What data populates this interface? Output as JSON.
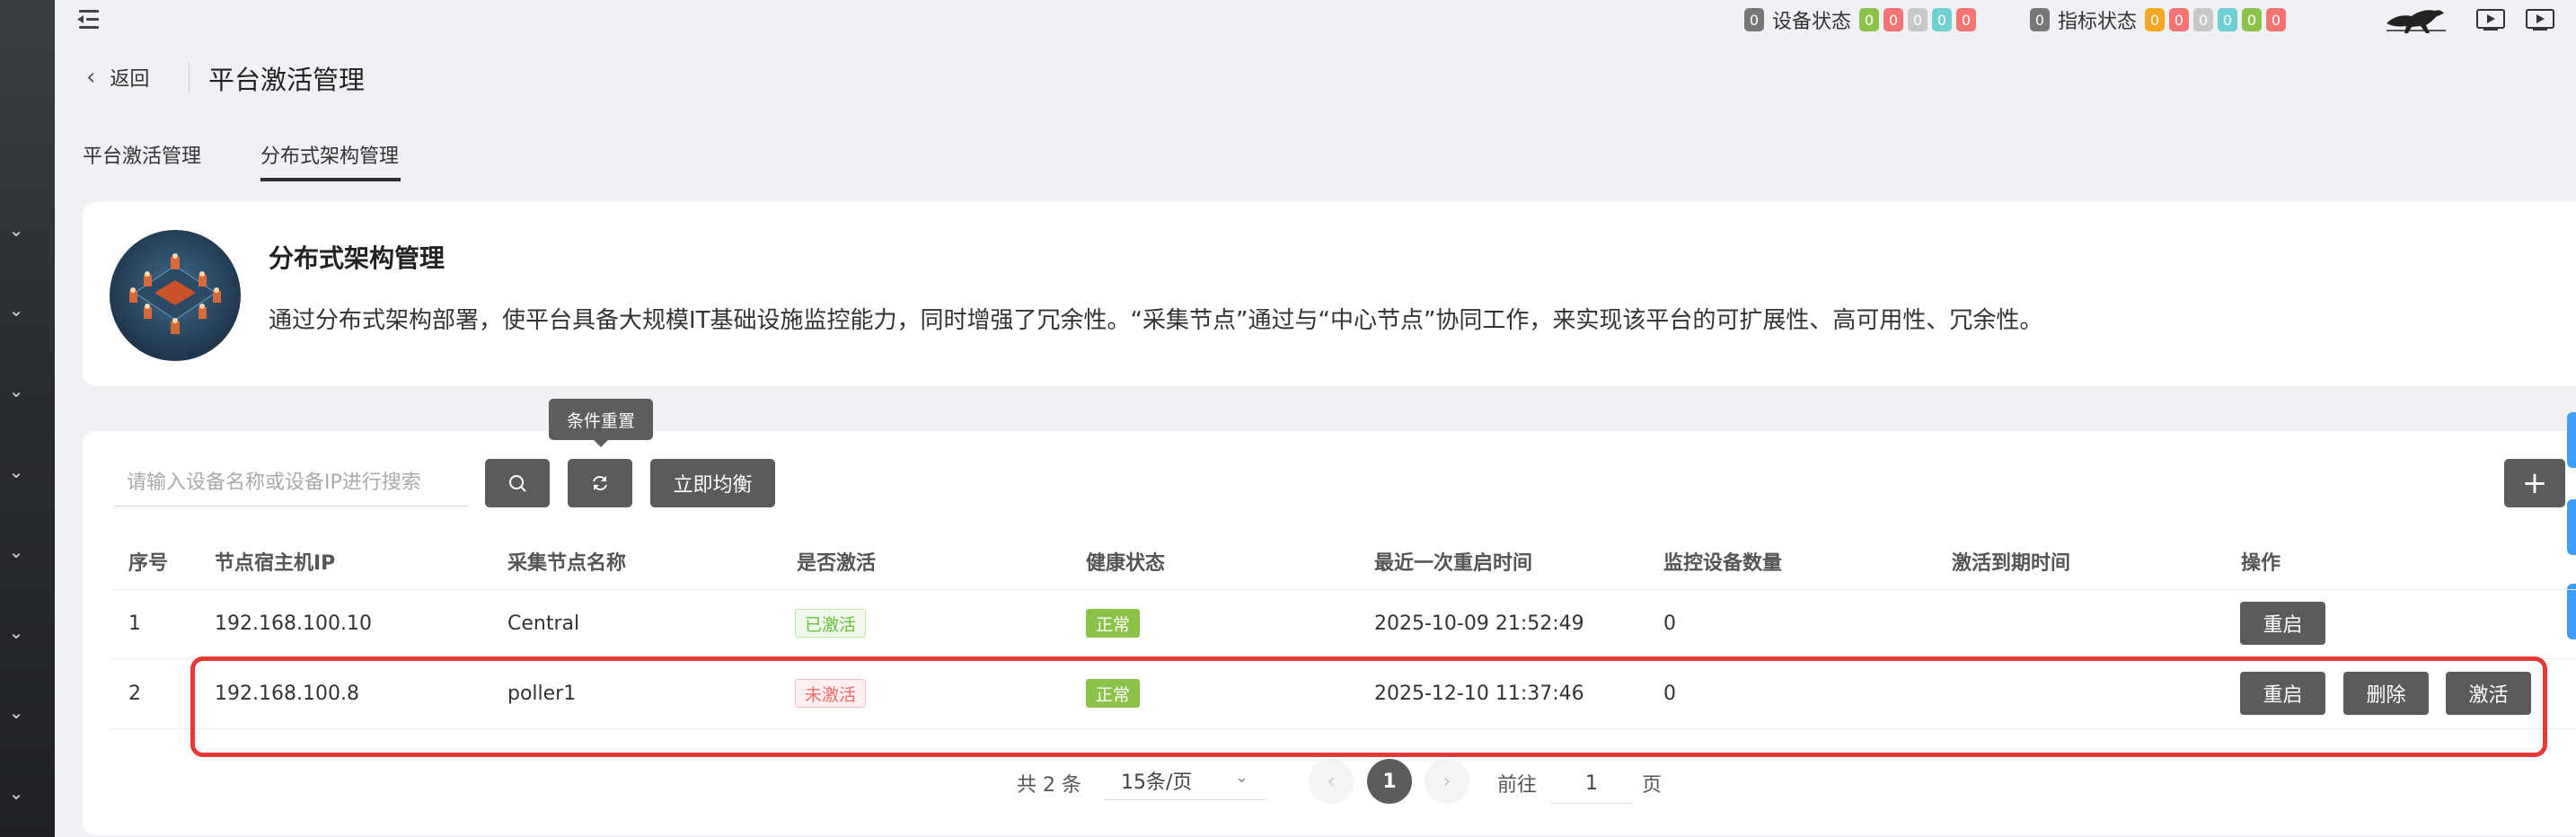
{
  "topbar": {
    "device_status_count": "0",
    "device_status_label": "设备状态",
    "device_badges": [
      {
        "value": "0",
        "color": "#8bc34a"
      },
      {
        "value": "0",
        "color": "#f57373"
      },
      {
        "value": "0",
        "color": "#c8c8c8"
      },
      {
        "value": "0",
        "color": "#6fcfd1"
      },
      {
        "value": "0",
        "color": "#f57373"
      }
    ],
    "metric_status_count": "0",
    "metric_status_label": "指标状态",
    "metric_badges": [
      {
        "value": "0",
        "color": "#f5a623"
      },
      {
        "value": "0",
        "color": "#f57373"
      },
      {
        "value": "0",
        "color": "#c8c8c8"
      },
      {
        "value": "0",
        "color": "#6fcfd1"
      },
      {
        "value": "0",
        "color": "#8bc34a"
      },
      {
        "value": "0",
        "color": "#f57373"
      }
    ],
    "neutral_color": "#777777"
  },
  "header": {
    "back_label": "返回",
    "title": "平台激活管理"
  },
  "tabs": [
    {
      "label": "平台激活管理",
      "active": false
    },
    {
      "label": "分布式架构管理",
      "active": true
    }
  ],
  "info_card": {
    "title": "分布式架构管理",
    "description": "通过分布式架构部署，使平台具备大规模IT基础设施监控能力，同时增强了冗余性。“采集节点”通过与“中心节点”协同工作，来实现该平台的可扩展性、高可用性、冗余性。"
  },
  "toolbar": {
    "search_placeholder": "请输入设备名称或设备IP进行搜索",
    "tooltip": "条件重置",
    "balance_label": "立即均衡",
    "add_icon": "+"
  },
  "table": {
    "headers": [
      "序号",
      "节点宿主机IP",
      "采集节点名称",
      "是否激活",
      "健康状态",
      "最近一次重启时间",
      "监控设备数量",
      "激活到期时间",
      "操作"
    ],
    "rows": [
      {
        "index": "1",
        "ip": "192.168.100.10",
        "name": "Central",
        "activated": "已激活",
        "health": "正常",
        "last_restart": "2025-10-09 21:52:49",
        "device_count": "0",
        "expire": "",
        "actions": [
          "重启"
        ]
      },
      {
        "index": "2",
        "ip": "192.168.100.8",
        "name": "poller1",
        "activated": "未激活",
        "health": "正常",
        "last_restart": "2025-12-10 11:37:46",
        "device_count": "0",
        "expire": "",
        "actions": [
          "重启",
          "删除",
          "激活"
        ]
      }
    ]
  },
  "pagination": {
    "total_text": "共 2 条",
    "page_size": "15条/页",
    "current_page": "1",
    "goto_label": "前往",
    "goto_value": "1",
    "page_unit": "页"
  }
}
